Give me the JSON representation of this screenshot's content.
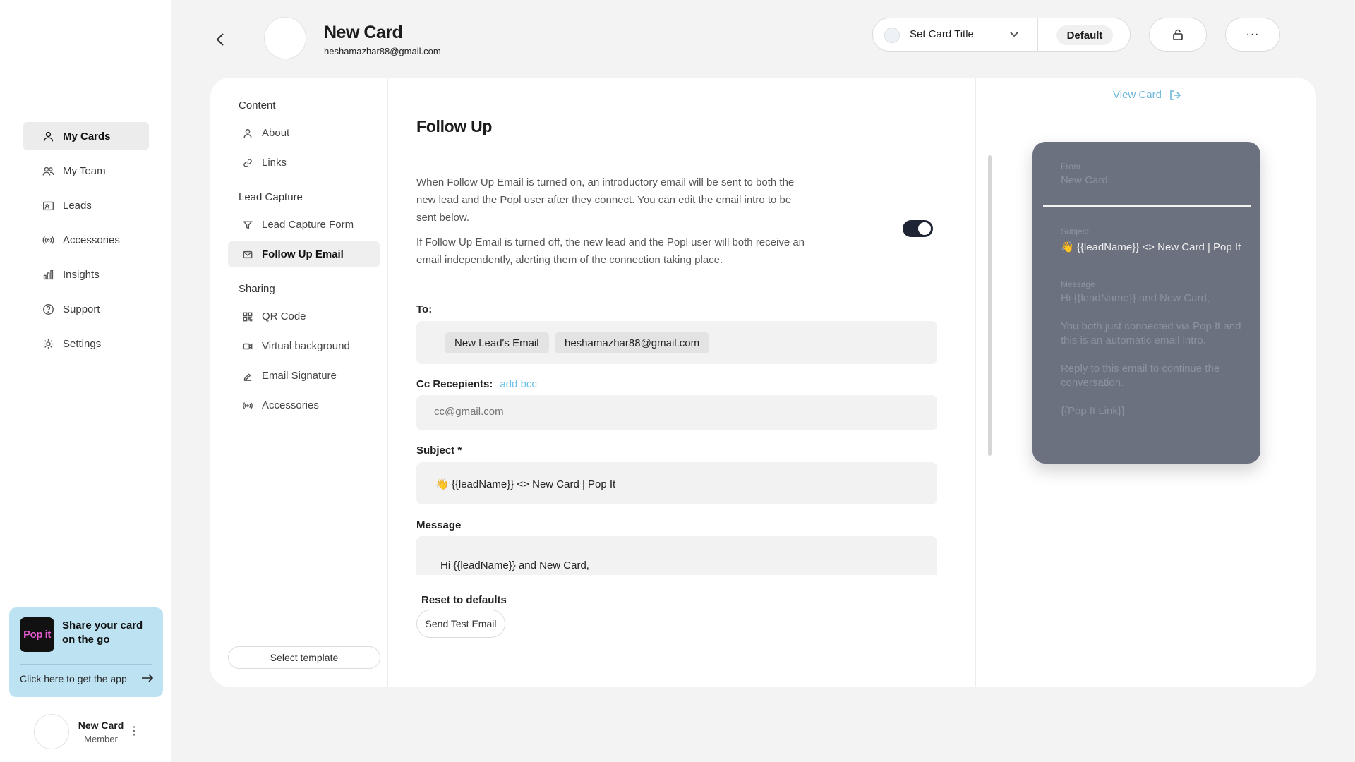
{
  "sidebar": {
    "nav": [
      {
        "label": "My Cards",
        "icon": "user-icon",
        "active": true
      },
      {
        "label": "My Team",
        "icon": "team-icon",
        "active": false
      },
      {
        "label": "Leads",
        "icon": "contact-card-icon",
        "active": false
      },
      {
        "label": "Accessories",
        "icon": "broadcast-icon",
        "active": false
      },
      {
        "label": "Insights",
        "icon": "bar-chart-icon",
        "active": false
      },
      {
        "label": "Support",
        "icon": "help-circle-icon",
        "active": false
      },
      {
        "label": "Settings",
        "icon": "gear-icon",
        "active": false
      }
    ],
    "promo": {
      "logo_text": "Pop it",
      "title": "Share your card on the go",
      "link": "Click here to get the app"
    },
    "user": {
      "name": "New Card",
      "role": "Member"
    }
  },
  "header": {
    "title": "New Card",
    "email": "heshamazhar88@gmail.com",
    "card_title_select": "Set Card Title",
    "default_badge": "Default"
  },
  "subnav": {
    "sections": [
      {
        "label": "Content"
      },
      {
        "label": "Lead Capture"
      },
      {
        "label": "Sharing"
      }
    ],
    "items": [
      {
        "label": "About",
        "icon": "person-icon"
      },
      {
        "label": "Links",
        "icon": "link-icon"
      },
      {
        "label": "Lead Capture Form",
        "icon": "filter-icon"
      },
      {
        "label": "Follow Up Email",
        "icon": "mail-icon",
        "active": true
      },
      {
        "label": "QR Code",
        "icon": "qr-code-icon"
      },
      {
        "label": "Virtual background",
        "icon": "video-icon"
      },
      {
        "label": "Email Signature",
        "icon": "signature-icon"
      },
      {
        "label": "Accessories",
        "icon": "broadcast-icon"
      }
    ],
    "select_template": "Select template"
  },
  "form": {
    "title": "Follow Up",
    "description_1": "When Follow Up Email is turned on, an introductory email will be sent to both the new lead and the Popl user after they connect. You can edit the email intro to be sent below.",
    "description_2": "If Follow Up Email is turned off, the new lead and the Popl user will both receive an email independently, alerting them of the connection taking place.",
    "toggle_on": true,
    "to_label": "To:",
    "to_chips": [
      "New Lead's Email",
      "heshamazhar88@gmail.com"
    ],
    "cc_label": "Cc Recepients:",
    "add_bcc": "add bcc",
    "cc_placeholder": "cc@gmail.com",
    "subject_label": "Subject *",
    "subject_value": "👋 {{leadName}} <> New Card | Pop It",
    "message_label": "Message",
    "message_first_line": "Hi {{leadName}} and New Card,",
    "reset_label": "Reset to defaults",
    "send_test": "Send Test Email"
  },
  "preview": {
    "view_card": "View Card",
    "from_label": "From",
    "from_value": "New Card",
    "subject_label": "Subject",
    "subject_value": "👋 {{leadName}} <> New Card | Pop It",
    "message_label": "Message",
    "message_lines": [
      "Hi {{leadName}} and New Card,",
      "You both just connected via Pop It and this is an automatic email intro.",
      "Reply to this email to continue the conversation.",
      "{{Pop It Link}}"
    ]
  },
  "colors": {
    "accent_link": "#6cc1e9",
    "promo_bg": "#bde3f3",
    "toggle_on": "#1e2433",
    "preview_card": "#6b717f"
  }
}
